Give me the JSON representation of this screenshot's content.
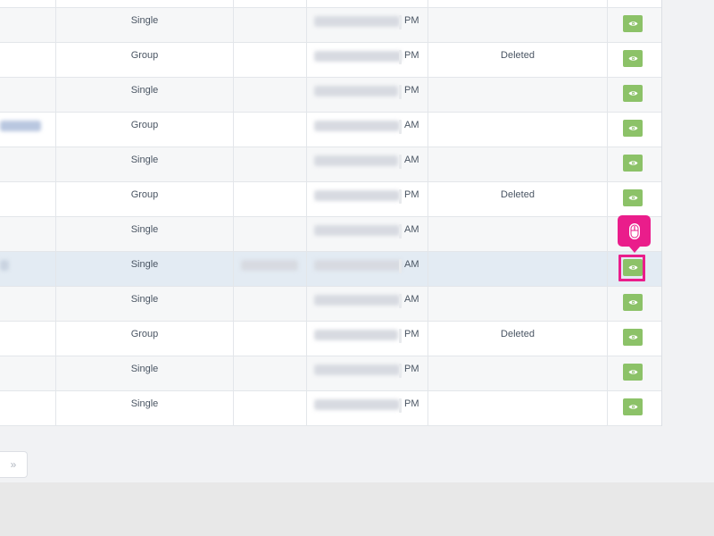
{
  "table": {
    "rows": [
      {
        "type": "Single",
        "ampm": "PM",
        "status": ""
      },
      {
        "type": "Group",
        "ampm": "PM",
        "status": "Deleted"
      },
      {
        "type": "Single",
        "ampm": "PM",
        "status": ""
      },
      {
        "type": "Group",
        "ampm": "AM",
        "status": ""
      },
      {
        "type": "Single",
        "ampm": "AM",
        "status": ""
      },
      {
        "type": "Group",
        "ampm": "PM",
        "status": "Deleted"
      },
      {
        "type": "Single",
        "ampm": "AM",
        "status": ""
      },
      {
        "type": "Single",
        "ampm": "AM",
        "status": ""
      },
      {
        "type": "Single",
        "ampm": "AM",
        "status": ""
      },
      {
        "type": "Group",
        "ampm": "PM",
        "status": "Deleted"
      },
      {
        "type": "Single",
        "ampm": "PM",
        "status": ""
      },
      {
        "type": "Single",
        "ampm": "PM",
        "status": ""
      }
    ],
    "action_icon": "eye-icon"
  },
  "pagination": {
    "next_label": "»"
  },
  "overlay": {
    "cursor_icon": "mouse-icon"
  },
  "colors": {
    "action_button": "#8cc268",
    "focus_highlight": "#ea1d8b",
    "selected_row": "#e3ebf3"
  }
}
